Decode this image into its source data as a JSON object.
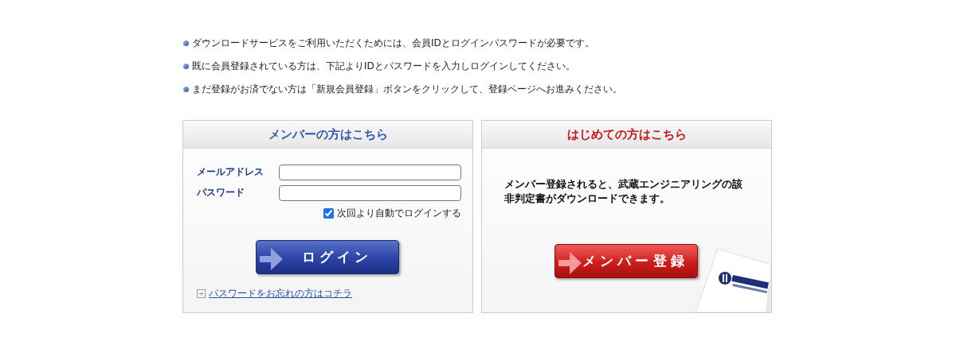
{
  "notes": [
    "ダウンロードサービスをご利用いただくためには、会員IDとログインパスワードが必要です。",
    "既に会員登録されている方は、下記よりIDとパスワードを入力しログインしてください。",
    "まだ登録がお済でない方は「新規会員登録」ボタンをクリックして、登録ページへお進みください。"
  ],
  "member_panel": {
    "title": "メンバーの方はこちら",
    "fields": [
      {
        "label": "メールアドレス"
      },
      {
        "label": "パスワード"
      }
    ],
    "remember": {
      "label": "次回より自動でログインする",
      "checked": true
    },
    "button": "ログイン",
    "link": "パスワードをお忘れの方はコチラ"
  },
  "new_panel": {
    "title": "はじめての方はこちら",
    "message": "メンバー登録されると、武蔵エンジニアリングの該非判定書がダウンロードできます。",
    "button": "メンバー登録"
  }
}
